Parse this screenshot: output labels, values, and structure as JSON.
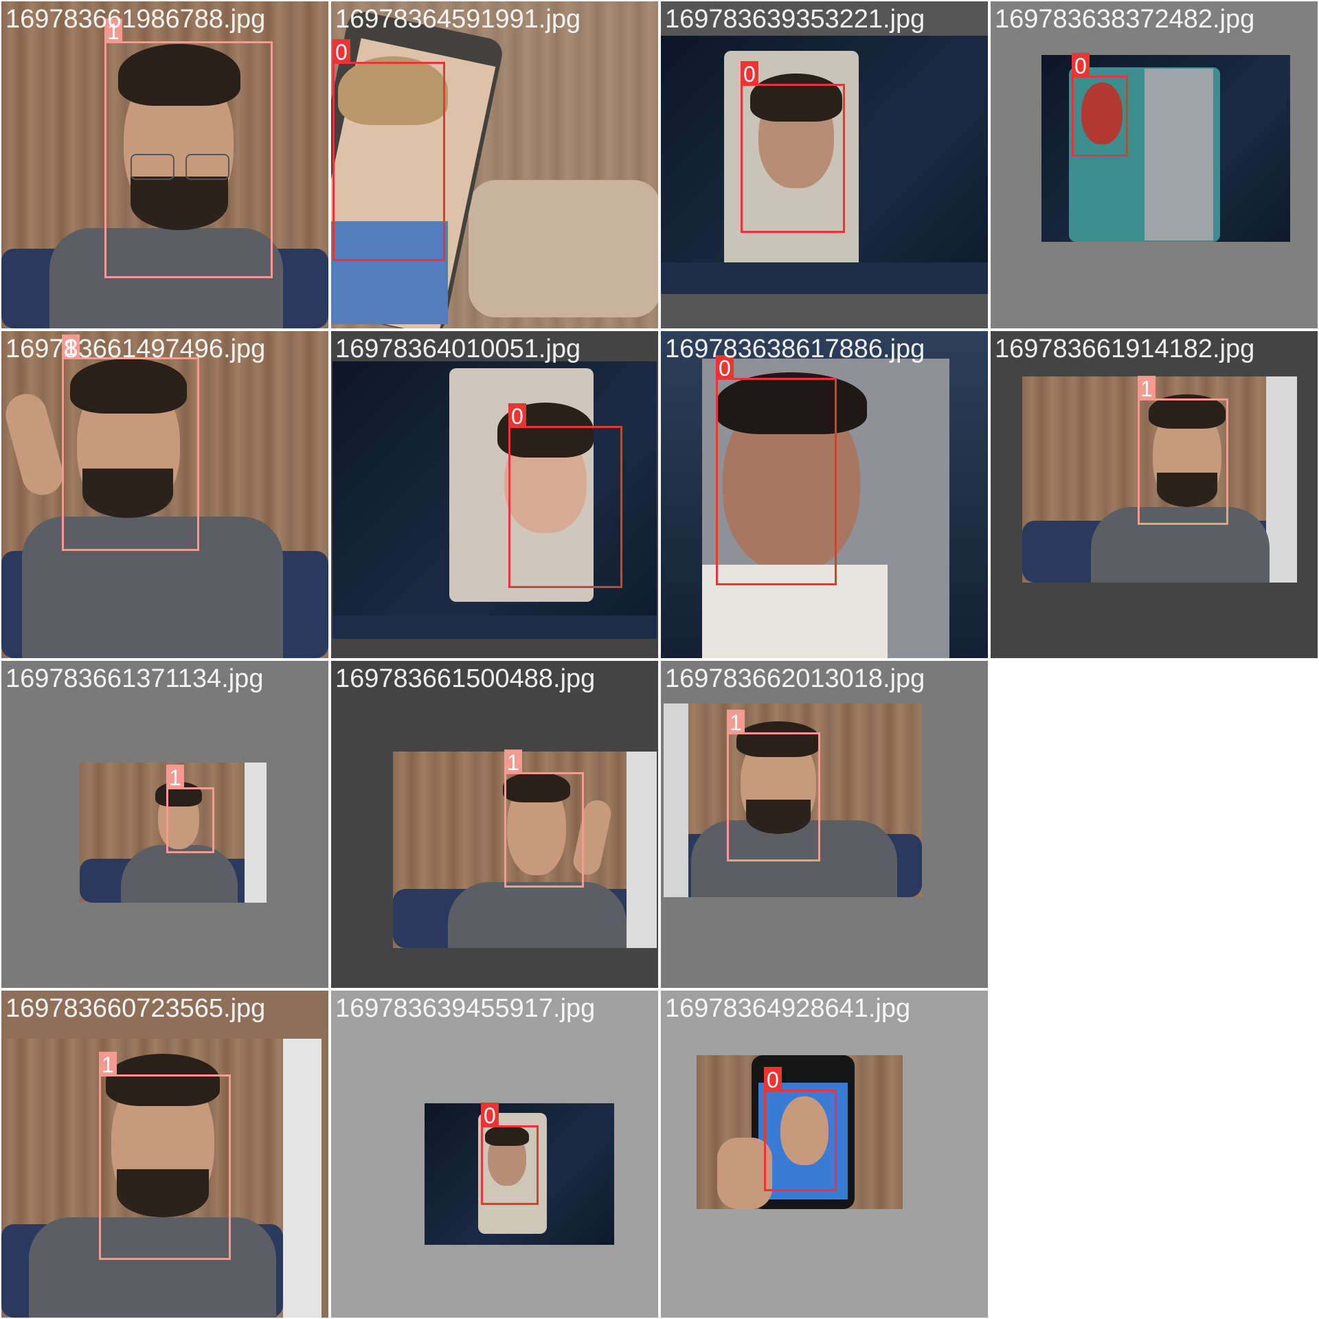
{
  "colors": {
    "class_0": "#ee3333",
    "class_1": "#f49a90",
    "tile_bg_light": "#a0a0a0",
    "tile_bg_mid": "#7a7a7a",
    "tile_bg_dark": "#444444"
  },
  "tiles": [
    {
      "filename": "169783661986788.jpg",
      "label": "1"
    },
    {
      "filename": "16978364591991.jpg",
      "label": "0"
    },
    {
      "filename": "169783639353221.jpg",
      "label": "0"
    },
    {
      "filename": "169783638372482.jpg",
      "label": "0"
    },
    {
      "filename": "169783661497496.jpg",
      "label": "1"
    },
    {
      "filename": "16978364010051.jpg",
      "label": "0"
    },
    {
      "filename": "169783638617886.jpg",
      "label": "0"
    },
    {
      "filename": "169783661914182.jpg",
      "label": "1"
    },
    {
      "filename": "169783661371134.jpg",
      "label": "1"
    },
    {
      "filename": "169783661500488.jpg",
      "label": "1"
    },
    {
      "filename": "169783662013018.jpg",
      "label": "1"
    },
    {
      "filename": "169783660723565.jpg",
      "label": "1"
    },
    {
      "filename": "169783639455917.jpg",
      "label": "0"
    },
    {
      "filename": "16978364928641.jpg",
      "label": "0"
    }
  ]
}
